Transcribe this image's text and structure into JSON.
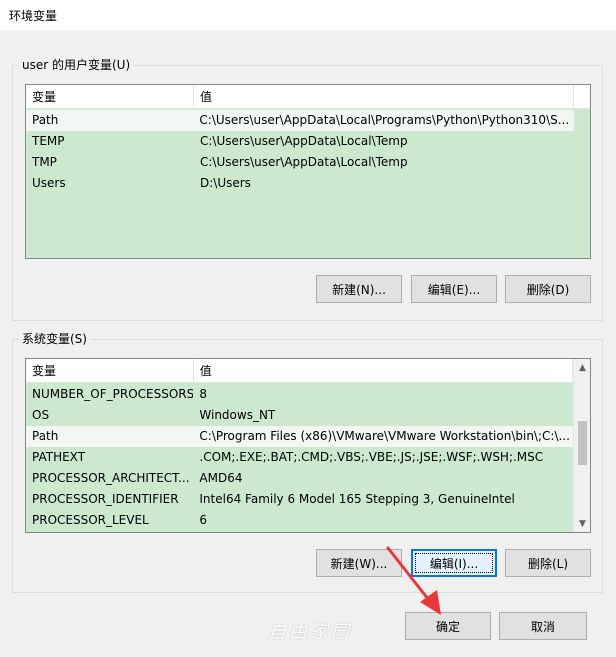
{
  "window": {
    "title": "环境变量"
  },
  "user_vars": {
    "group_label": "user 的用户变量(U)",
    "columns": [
      "变量",
      "值"
    ],
    "rows": [
      {
        "name": "Path",
        "value": "C:\\Users\\user\\AppData\\Local\\Programs\\Python\\Python310\\S..."
      },
      {
        "name": "TEMP",
        "value": "C:\\Users\\user\\AppData\\Local\\Temp"
      },
      {
        "name": "TMP",
        "value": "C:\\Users\\user\\AppData\\Local\\Temp"
      },
      {
        "name": "Users",
        "value": "D:\\Users"
      }
    ],
    "buttons": {
      "new": "新建(N)...",
      "edit": "编辑(E)...",
      "delete": "删除(D)"
    }
  },
  "system_vars": {
    "group_label": "系统变量(S)",
    "columns": [
      "变量",
      "值"
    ],
    "rows": [
      {
        "name": "NUMBER_OF_PROCESSORS",
        "value": "8"
      },
      {
        "name": "OS",
        "value": "Windows_NT"
      },
      {
        "name": "Path",
        "value": "C:\\Program Files (x86)\\VMware\\VMware Workstation\\bin\\;C:\\..."
      },
      {
        "name": "PATHEXT",
        "value": ".COM;.EXE;.BAT;.CMD;.VBS;.VBE;.JS;.JSE;.WSF;.WSH;.MSC"
      },
      {
        "name": "PROCESSOR_ARCHITECT...",
        "value": "AMD64"
      },
      {
        "name": "PROCESSOR_IDENTIFIER",
        "value": "Intel64 Family 6 Model 165 Stepping 3, GenuineIntel"
      },
      {
        "name": "PROCESSOR_LEVEL",
        "value": "6"
      }
    ],
    "buttons": {
      "new": "新建(W)...",
      "edit": "编辑(I)...",
      "delete": "删除(L)"
    }
  },
  "footer": {
    "ok": "确定",
    "cancel": "取消"
  },
  "watermark": "自由家园",
  "colors": {
    "list_bg": "#cce8cf",
    "focus": "#0078d7",
    "arrow": "#e8383d"
  }
}
